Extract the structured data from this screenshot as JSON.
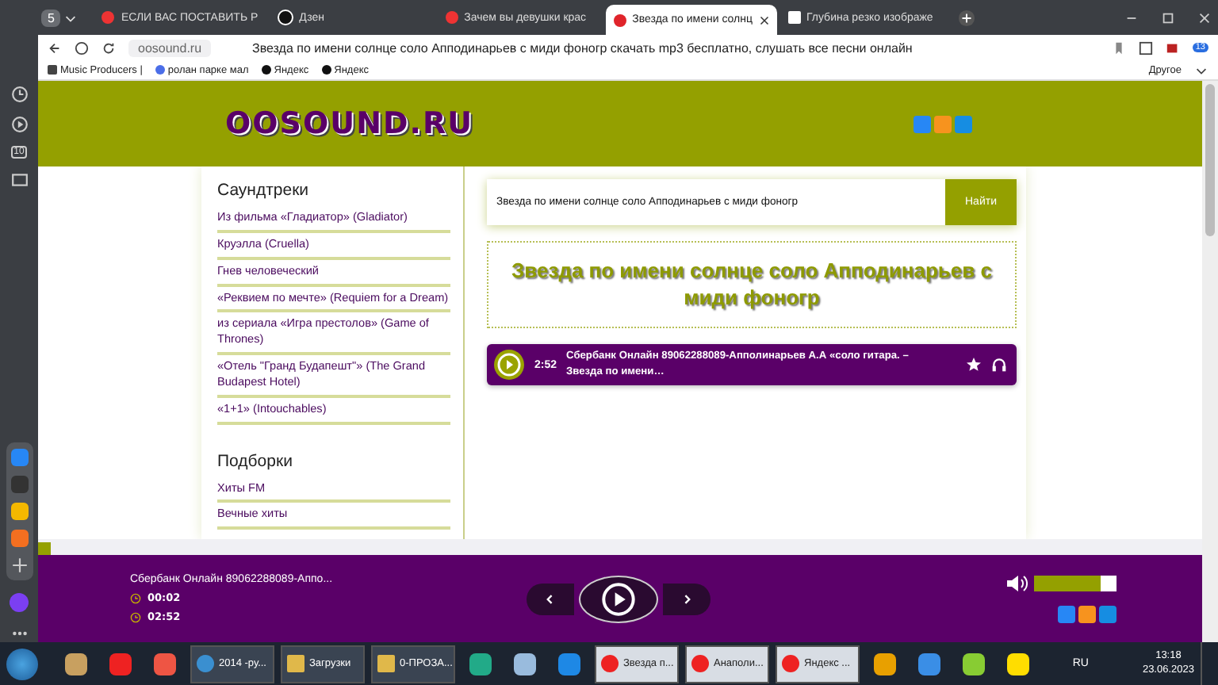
{
  "browser": {
    "profile_badge": "5",
    "tabs": [
      {
        "title": "ЕСЛИ ВАС ПОСТАВИТЬ Р",
        "selected": false,
        "kind": "yandex"
      },
      {
        "title": "Дзен",
        "selected": false,
        "kind": "dzen"
      },
      {
        "title": "Зачем вы девушки крас",
        "selected": false,
        "kind": "yandex"
      },
      {
        "title": "Звезда по имени солнц",
        "selected": true,
        "kind": "site"
      },
      {
        "title": "Глубина резко изображе",
        "selected": false,
        "kind": "wiki"
      }
    ],
    "address": "oosound.ru",
    "page_title": "Звезда по имени солнце соло Апподинарьев с миди фоногр скачать mp3 бесплатно, слушать все песни онлайн",
    "downloads_badge": "13",
    "bookmarks": [
      {
        "label": "Music Producers |",
        "kind": "grid"
      },
      {
        "label": "ролан парке мал",
        "kind": "search"
      },
      {
        "label": "Яндекс",
        "kind": "yandex"
      },
      {
        "label": "Яндекс",
        "kind": "yandex"
      }
    ],
    "more": "Другое",
    "sidebar_badge": "10"
  },
  "site": {
    "logo": "OOSOUND.RU",
    "sections": [
      {
        "heading": "Саундтреки",
        "items": [
          "Из фильма «Гладиатор» (Gladiator)",
          "Круэлла (Cruella)",
          "Гнев человеческий",
          "«Реквием по мечте» (Requiem for a Dream)",
          "из сериала «Игра престолов» (Game of Thrones)",
          "«Отель \"Гранд Будапешт\"» (The Grand Budapest Hotel)",
          "«1+1» (Intouchables)"
        ]
      },
      {
        "heading": "Подборки",
        "items": [
          "Хиты FM",
          "Вечные хиты"
        ]
      }
    ],
    "search": {
      "value": "Звезда по имени солнце соло Апподинарьев с миди фоногр",
      "button": "Найти"
    },
    "heading": "Звезда по имени солнце соло Апподинарьев с миди фоногр",
    "track": {
      "duration": "2:52",
      "title": "Сбербанк Онлайн 89062288089-Апполинарьев А.А «соло гитара. – Звезда по имени…"
    },
    "player": {
      "title": "Сбербанк Онлайн 89062288089-Аппо...",
      "elapsed": "00:02",
      "total": "02:52",
      "volume": {
        "level": 0.8
      }
    }
  },
  "taskbar": {
    "items": [
      {
        "label": "2014 -ру...",
        "kind": "globe"
      },
      {
        "label": "Загрузки",
        "kind": "folder"
      },
      {
        "label": "0-ПРОЗА...",
        "kind": "folder"
      },
      {
        "label": "Звезда п...",
        "kind": "yandex"
      },
      {
        "label": "Анаполи...",
        "kind": "yandex"
      },
      {
        "label": "Яндекс ...",
        "kind": "yandex"
      }
    ],
    "lang": "RU",
    "time": "13:18",
    "date": "23.06.2023"
  }
}
